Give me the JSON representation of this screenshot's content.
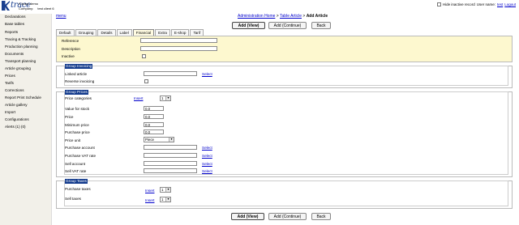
{
  "header": {
    "logo_text": "trace",
    "user_line": "K-trace demo",
    "company_label": "Company:",
    "company_value": "test client 6",
    "hide_inactive_label": "Hide inactive record",
    "user_name_label": "User name:",
    "user_name": "test",
    "logout": "Logout"
  },
  "sidebar": {
    "items": [
      "Declarations",
      "Base tables",
      "Reports",
      "Tracing & Tracking",
      "Production planning",
      "Documents",
      "Transport planning",
      "Article grouping",
      "Prices",
      "Tarifs",
      "Corrections",
      "Report Print Schedule",
      "Article gallery",
      "Import",
      "Configurations",
      "Alerts (1) (0)"
    ]
  },
  "top": {
    "menu_link": "menu",
    "breadcrumb_home": "Administration Home",
    "breadcrumb_sep1": " > ",
    "breadcrumb_table": "Table Article",
    "breadcrumb_sep2": " > ",
    "breadcrumb_current": "Add Article"
  },
  "actions": {
    "add_view": "Add (View)",
    "add_continue": "Add (Continue)",
    "back": "Back"
  },
  "tabs": [
    "Default",
    "Grouping",
    "Details",
    "Label",
    "Financial",
    "Extra",
    "E-shop",
    "Tarif"
  ],
  "active_tab": "Financial",
  "general": {
    "reference_label": "Reference",
    "description_label": "Description",
    "inactive_label": "Inactive"
  },
  "invoicing": {
    "title": "Group Invoicing",
    "linked_article_label": "Linked article",
    "select_label": "Select",
    "reverse_invoicing_label": "Reverse invoicing"
  },
  "prices": {
    "title": "Group Prices",
    "price_categories_label": "Price categories",
    "insert_label": "Insert",
    "price_categories_count": "1",
    "value_for_stock_label": "Value for stock",
    "value_for_stock": "0.0",
    "price_label": "Price",
    "price": "0.0",
    "minimum_price_label": "Minimum price",
    "minimum_price": "0.0",
    "purchase_price_label": "Purchase price",
    "purchase_price": "0.0",
    "price_unit_label": "Price unit",
    "price_unit": "Piece",
    "purchase_account_label": "Purchase account",
    "purchase_vat_label": "Purchase VAT rate",
    "sell_account_label": "Sell account",
    "sell_vat_label": "Sell VAT rate",
    "select_label": "Select"
  },
  "taxes": {
    "title": "Group Taxes",
    "purchase_taxes_label": "Purchase taxes",
    "sell_taxes_label": "Sell taxes",
    "insert_label": "Insert",
    "purchase_taxes_count": "1",
    "sell_taxes_count": "1"
  },
  "colors": {
    "sidebar_bg": "#f2f0e9",
    "panel_bg": "#fdf8cf",
    "group_title_bg": "#123a8c",
    "link": "#0000cc"
  }
}
